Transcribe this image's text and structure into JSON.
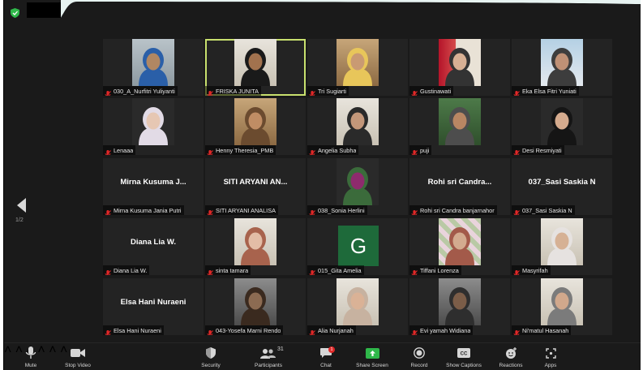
{
  "pager": {
    "page": "1/2"
  },
  "participants": [
    {
      "name": "030_A_Nurfitri Yuliyanti",
      "display": "video",
      "bg": "bg-room",
      "skin": "#b08763",
      "scarf": "#2a5fa8"
    },
    {
      "name": "FRISKA JUNITA",
      "display": "video",
      "active": true,
      "bg": "bg-light",
      "skin": "#a2724e",
      "scarf": "#1a1a1a"
    },
    {
      "name": "Tri Sugiarti",
      "display": "video",
      "bg": "bg-warm",
      "skin": "#c99a73",
      "scarf": "#e8c65a"
    },
    {
      "name": "Gustinawati",
      "display": "video",
      "bg": "bg-red",
      "skin": "#d7b094",
      "scarf": "#333333"
    },
    {
      "name": "Eka Elsa Fitri Yuniati",
      "display": "video",
      "bg": "bg-sky",
      "skin": "#bf9176",
      "scarf": "#3d3d3d"
    },
    {
      "name": "Lenaaa",
      "display": "video",
      "bg": "bg-dark",
      "skin": "#e6c7b3",
      "scarf": "#e2dbe6"
    },
    {
      "name": "Henny Theresia_PMB",
      "display": "video",
      "bg": "bg-warm",
      "skin": "#c08d64",
      "scarf": "#6b4b2f"
    },
    {
      "name": "Angelia Subha",
      "display": "video",
      "bg": "bg-light",
      "skin": "#c3977a",
      "scarf": "#2a2a2a"
    },
    {
      "name": "puji",
      "display": "video",
      "bg": "bg-green",
      "skin": "#b98663",
      "scarf": "#4d4d4d"
    },
    {
      "name": "Desi Resmiyati",
      "display": "video",
      "bg": "bg-dark",
      "skin": "#d5ab8e",
      "scarf": "#151515"
    },
    {
      "name": "Mirna Kusuma Jania Putri",
      "display": "name",
      "big": "Mirna Kusuma J..."
    },
    {
      "name": "SITI ARYANI ANALISA",
      "display": "name",
      "big": "SITI ARYANI AN..."
    },
    {
      "name": "038_Sonia Herlini",
      "display": "video",
      "bg": "bg-dark",
      "skin": "#8e2b6d",
      "scarf": "#3b6b3b"
    },
    {
      "name": "Rohi sri Candra banjarnahor",
      "display": "name",
      "big": "Rohi sri Candra..."
    },
    {
      "name": "037_Sasi Saskia N",
      "display": "name",
      "big": "037_Sasi Saskia N"
    },
    {
      "name": "Diana Lia W.",
      "display": "name",
      "big": "Diana Lia W."
    },
    {
      "name": "sinta tamara",
      "display": "video",
      "bg": "bg-light",
      "skin": "#e3bda6",
      "scarf": "#a8634d"
    },
    {
      "name": "015_Gita Amelia",
      "display": "letter",
      "letter": "G"
    },
    {
      "name": "Tiffani Lorenza",
      "display": "video",
      "bg": "bg-floral",
      "skin": "#d3ab8f",
      "scarf": "#a35a4a"
    },
    {
      "name": "Masyrifah",
      "display": "video",
      "bg": "bg-light",
      "skin": "#d6b195",
      "scarf": "#e6e2e0"
    },
    {
      "name": "Elsa Hani Nuraeni",
      "display": "name",
      "big": "Elsa Hani Nuraeni"
    },
    {
      "name": "043-Yosefa Marni Rendo",
      "display": "video",
      "bg": "bg-gray",
      "skin": "#8c6b52",
      "scarf": "#3a2a1f"
    },
    {
      "name": "Alia Nurjanah",
      "display": "video",
      "bg": "bg-light",
      "skin": "#dab296",
      "scarf": "#c7b2a0"
    },
    {
      "name": "Evi yamah Widiana",
      "display": "video",
      "bg": "bg-gray",
      "skin": "#7b5d48",
      "scarf": "#2e2e2e"
    },
    {
      "name": "Ni'matul Hasanah",
      "display": "video",
      "bg": "bg-light",
      "skin": "#d1a88c",
      "scarf": "#7b7b7b"
    }
  ],
  "toolbar": {
    "mute": "Mute",
    "stop_video": "Stop Video",
    "security": "Security",
    "participants": "Participants",
    "participants_count": "31",
    "chat": "Chat",
    "chat_badge": "1",
    "share_screen": "Share Screen",
    "record": "Record",
    "show_captions": "Show Captions",
    "reactions": "Reactions",
    "apps": "Apps"
  },
  "colors": {
    "active_speaker": "#c8e06e",
    "share_green": "#2fb84a",
    "muted_red": "#e02828",
    "bar_bg": "#1a1a1a"
  }
}
